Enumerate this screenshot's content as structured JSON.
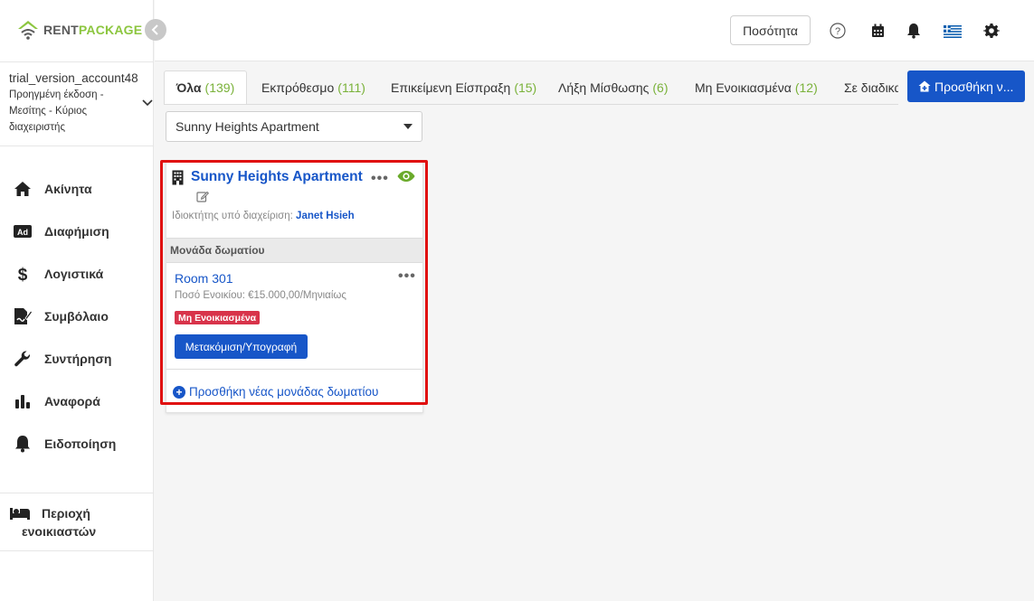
{
  "brand": {
    "rent": "RENT",
    "package": "PACKAGE"
  },
  "account": {
    "name": "trial_version_account48",
    "role": "Προηγμένη έκδοση - Μεσίτης - Κύριος διαχειριστής"
  },
  "nav": [
    {
      "label": "Ακίνητα",
      "icon": "home-icon"
    },
    {
      "label": "Διαφήμιση",
      "icon": "ad-icon"
    },
    {
      "label": "Λογιστικά",
      "icon": "dollar-icon"
    },
    {
      "label": "Συμβόλαιο",
      "icon": "contract-icon"
    },
    {
      "label": "Συντήρηση",
      "icon": "wrench-icon"
    },
    {
      "label": "Αναφορά",
      "icon": "bar-chart-icon"
    },
    {
      "label": "Ειδοποίηση",
      "icon": "bell-icon"
    }
  ],
  "tenant_area": {
    "line1": "Περιοχή",
    "line2": "ενοικιαστών"
  },
  "header": {
    "quantity_label": "Ποσότητα"
  },
  "tabs": [
    {
      "label": "Όλα",
      "count": "(139)"
    },
    {
      "label": "Εκπρόθεσμο",
      "count": "(111)"
    },
    {
      "label": "Επικείμενη Είσπραξη",
      "count": "(15)"
    },
    {
      "label": "Λήξη Μίσθωσης",
      "count": "(6)"
    },
    {
      "label": "Μη Ενοικιασμένα",
      "count": "(12)"
    },
    {
      "label": "Σε διαδικασία",
      "count": ""
    }
  ],
  "add_property_label": "Προσθήκη ν...",
  "property_select": {
    "value": "Sunny Heights Apartment"
  },
  "property": {
    "title": "Sunny Heights Apartment",
    "owner_label": "Ιδιοκτήτης υπό διαχείριση:",
    "owner_name": "Janet Hsieh",
    "unit_header": "Μονάδα δωματίου",
    "room": {
      "title": "Room 301",
      "rent": "Ποσό Ενοικίου: €15.000,00/Μηνιαίως",
      "status": "Μη Ενοικιασμένα",
      "action_label": "Μετακόμιση/Υπογραφή"
    },
    "add_room_label": "Προσθήκη νέας μονάδας δωματίου"
  },
  "colors": {
    "primary": "#1756c8",
    "accent": "#8cc63f",
    "danger": "#d8334a",
    "highlight": "#e01010"
  }
}
